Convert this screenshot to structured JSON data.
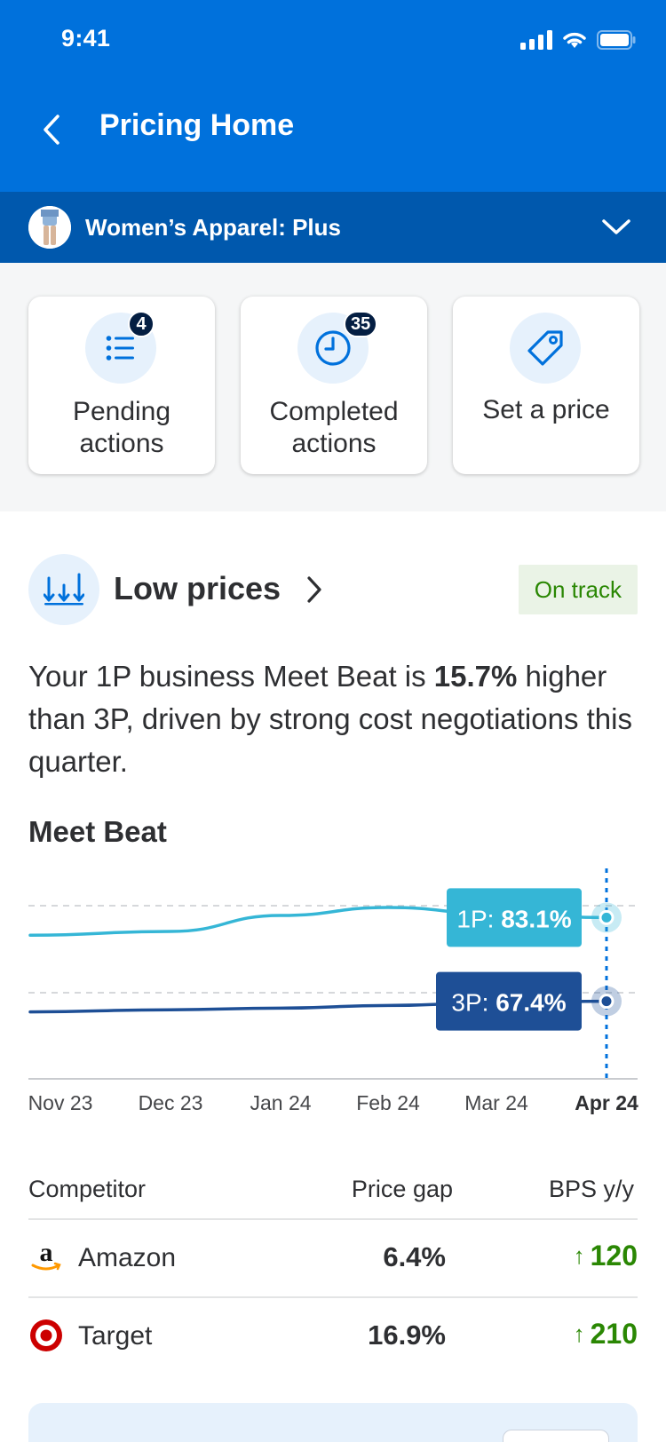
{
  "status": {
    "time": "9:41"
  },
  "nav": {
    "title": "Pricing Home"
  },
  "department": {
    "name": "Women’s Apparel: Plus"
  },
  "actions": [
    {
      "label": "Pending actions",
      "badge": "4",
      "icon": "list-icon"
    },
    {
      "label": "Completed actions",
      "badge": "35",
      "icon": "clock-icon"
    },
    {
      "label": "Set a price",
      "badge": "",
      "icon": "price-tag-icon"
    }
  ],
  "low_prices": {
    "title": "Low prices",
    "status": "On track",
    "summary_prefix": "Your 1P business Meet Beat is ",
    "summary_value": "15.7%",
    "summary_suffix": " higher than 3P, driven by strong cost negotiations this quarter."
  },
  "chart_data": {
    "type": "line",
    "title": "Meet Beat",
    "categories": [
      "Nov 23",
      "Dec 23",
      "Jan 24",
      "Feb 24",
      "Mar 24",
      "Apr 24"
    ],
    "series": [
      {
        "name": "1P",
        "values": [
          79.8,
          80.5,
          83.5,
          85.0,
          83.8,
          83.1
        ],
        "color": "#35b6d6",
        "label": "83.1%"
      },
      {
        "name": "3P",
        "values": [
          65.4,
          65.8,
          66.1,
          66.6,
          67.1,
          67.4
        ],
        "color": "#1e4f96",
        "label": "67.4%"
      }
    ],
    "ylim": [
      55,
      92
    ],
    "grid": "dashed",
    "highlight": "Apr 24"
  },
  "table": {
    "headers": {
      "competitor": "Competitor",
      "gap": "Price gap",
      "bps": "BPS y/y"
    },
    "rows": [
      {
        "name": "Amazon",
        "gap": "6.4%",
        "bps": "120",
        "logo": "amazon-logo"
      },
      {
        "name": "Target",
        "gap": "16.9%",
        "bps": "210",
        "logo": "target-logo"
      }
    ]
  },
  "colors": {
    "primary": "#0071dc",
    "dept_bar": "#0058ad",
    "positive": "#2a8703",
    "badge": "#041e42"
  }
}
